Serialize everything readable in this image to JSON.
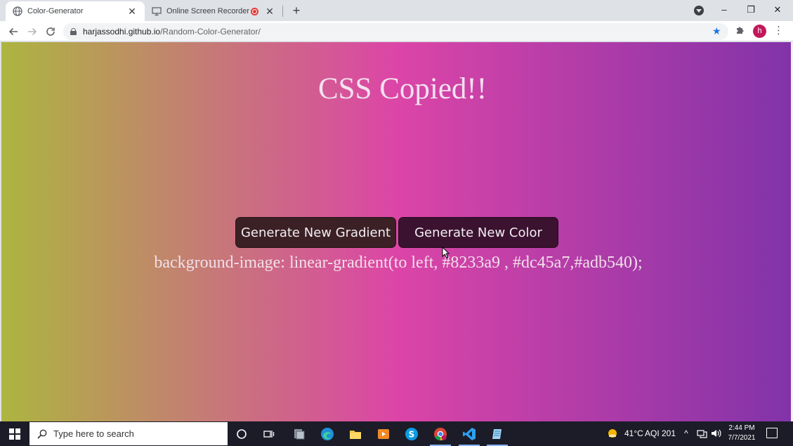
{
  "browser": {
    "tabs": [
      {
        "title": "Color-Generator",
        "active": true
      },
      {
        "title": "Online Screen Recorder",
        "active": false
      }
    ],
    "new_tab_label": "+",
    "close_glyph": "✕",
    "url": {
      "host": "harjassodhi.github.io",
      "path": "/Random-Color-Generator/"
    },
    "profile_initial": "h",
    "window_controls": {
      "minimize": "–",
      "restore": "❐",
      "close": "✕"
    }
  },
  "page": {
    "title": "CSS Copied!!",
    "buttons": {
      "gradient": "Generate New Gradient",
      "color": "Generate New Color"
    },
    "css_output": "background-image: linear-gradient(to left, #8233a9 , #dc45a7,#adb540);",
    "gradient_colors": [
      "#8233a9",
      "#dc45a7",
      "#adb540"
    ]
  },
  "taskbar": {
    "search_placeholder": "Type here to search",
    "weather": "41°C",
    "aqi": "AQI 201",
    "time": "2:44 PM",
    "date": "7/7/2021"
  },
  "colors": {
    "chrome_frame": "#dee1e6",
    "taskbar": "#1b1c28",
    "bookmark_star": "#1a73e8",
    "avatar": "#c2185b"
  }
}
